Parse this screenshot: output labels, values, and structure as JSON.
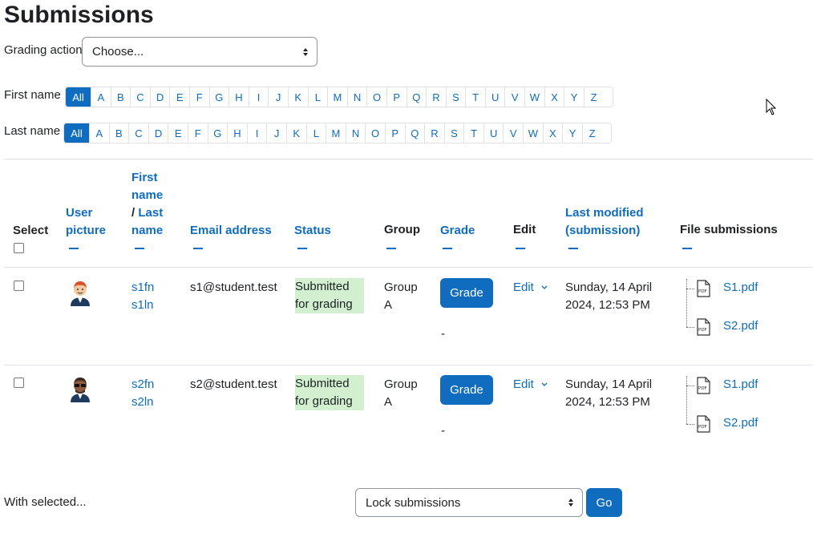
{
  "page": {
    "title": "Submissions"
  },
  "grading_action": {
    "label": "Grading action",
    "value": "Choose..."
  },
  "first_name_filter": {
    "label": "First name",
    "letters": [
      "All",
      "A",
      "B",
      "C",
      "D",
      "E",
      "F",
      "G",
      "H",
      "I",
      "J",
      "K",
      "L",
      "M",
      "N",
      "O",
      "P",
      "Q",
      "R",
      "S",
      "T",
      "U",
      "V",
      "W",
      "X",
      "Y",
      "Z"
    ]
  },
  "last_name_filter": {
    "label": "Last name",
    "letters": [
      "All",
      "A",
      "B",
      "C",
      "D",
      "E",
      "F",
      "G",
      "H",
      "I",
      "J",
      "K",
      "L",
      "M",
      "N",
      "O",
      "P",
      "Q",
      "R",
      "S",
      "T",
      "U",
      "V",
      "W",
      "X",
      "Y",
      "Z"
    ]
  },
  "table": {
    "headers": {
      "select": "Select",
      "user_picture_1": "User",
      "user_picture_2": "picture",
      "first_name_1": "First",
      "first_name_2": "name",
      "slash": "/",
      "last_name_1": "Last",
      "last_name_2": "name",
      "email": "Email address",
      "status": "Status",
      "group": "Group",
      "grade": "Grade",
      "edit": "Edit",
      "last_modified_1": "Last modified",
      "last_modified_2": "(submission)",
      "file_submissions": "File submissions"
    },
    "rows": [
      {
        "first_name": "s1fn",
        "last_name": "s1ln",
        "email": "s1@student.test",
        "status_1": "Submitted",
        "status_2": "for grading",
        "group_1": "Group",
        "group_2": "A",
        "grade_button": "Grade",
        "grade_value": "-",
        "edit": "Edit",
        "modified_1": "Sunday, 14 April",
        "modified_2": "2024, 12:53 PM",
        "files": [
          "S1.pdf",
          "S2.pdf"
        ]
      },
      {
        "first_name": "s2fn",
        "last_name": "s2ln",
        "email": "s2@student.test",
        "status_1": "Submitted",
        "status_2": "for grading",
        "group_1": "Group",
        "group_2": "A",
        "grade_button": "Grade",
        "grade_value": "-",
        "edit": "Edit",
        "modified_1": "Sunday, 14 April",
        "modified_2": "2024, 12:53 PM",
        "files": [
          "S1.pdf",
          "S2.pdf"
        ]
      }
    ]
  },
  "footer": {
    "with_selected": "With selected...",
    "action_value": "Lock submissions",
    "go_button": "Go"
  },
  "pdf_icon_text": "PDF"
}
